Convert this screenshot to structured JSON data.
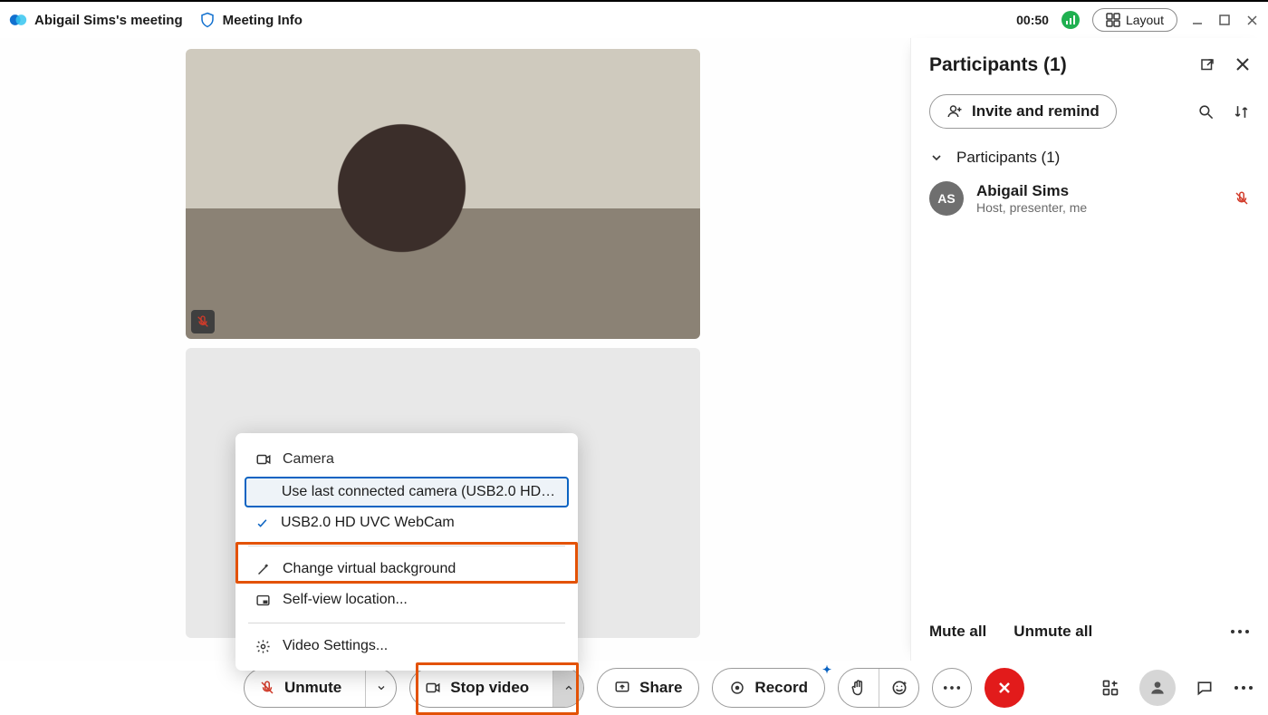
{
  "header": {
    "meeting_title": "Abigail Sims's meeting",
    "meeting_info": "Meeting Info",
    "elapsed": "00:50",
    "layout_label": "Layout"
  },
  "video_menu": {
    "camera_header": "Camera",
    "use_last": "Use last connected camera (USB2.0 HD UV…",
    "camera_device": "USB2.0 HD UVC WebCam",
    "change_bg": "Change virtual background",
    "self_view": "Self-view location...",
    "video_settings": "Video Settings..."
  },
  "controls": {
    "unmute": "Unmute",
    "stop_video": "Stop video",
    "share": "Share",
    "record": "Record"
  },
  "panel": {
    "title": "Participants (1)",
    "invite": "Invite and remind",
    "section": "Participants (1)",
    "participant": {
      "initials": "AS",
      "name": "Abigail Sims",
      "role": "Host, presenter, me"
    },
    "mute_all": "Mute all",
    "unmute_all": "Unmute all"
  }
}
